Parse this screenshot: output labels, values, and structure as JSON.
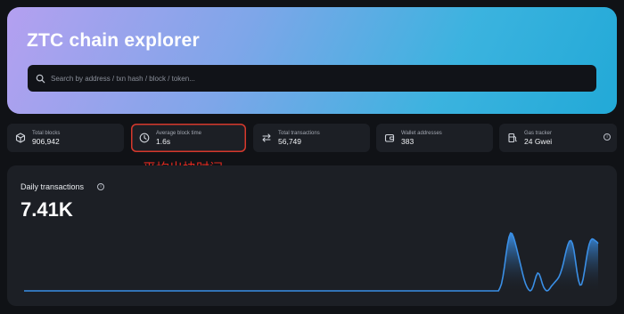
{
  "header": {
    "title": "ZTC chain explorer",
    "search_placeholder": "Search by address / txn hash / block / token..."
  },
  "stats": [
    {
      "label": "Total blocks",
      "value": "906,942",
      "icon": "cube-icon"
    },
    {
      "label": "Average block time",
      "value": "1.6s",
      "icon": "clock-icon"
    },
    {
      "label": "Total transactions",
      "value": "56,749",
      "icon": "transfer-arrows-icon"
    },
    {
      "label": "Wallet addresses",
      "value": "383",
      "icon": "wallet-icon"
    },
    {
      "label": "Gas tracker",
      "value": "24 Gwei",
      "icon": "gas-pump-icon"
    }
  ],
  "annotation": "平均出块时间",
  "daily": {
    "title": "Daily transactions",
    "value": "7.41K"
  },
  "chart_data": {
    "type": "area",
    "values": [
      0,
      0,
      0,
      0,
      0,
      0,
      0,
      0,
      0,
      0,
      0,
      0,
      0,
      0,
      0,
      0,
      0,
      0,
      0,
      0,
      0,
      0,
      0,
      0,
      0,
      0,
      0,
      0,
      0,
      0,
      0,
      0,
      0,
      0,
      0,
      0,
      0,
      0,
      0,
      0,
      0,
      0,
      0,
      0,
      0,
      0,
      0,
      0,
      0,
      0,
      0,
      0,
      0,
      0,
      0,
      0,
      0,
      0,
      0,
      0,
      0,
      0,
      0,
      0,
      0,
      0,
      0,
      0,
      0,
      0,
      0,
      0,
      0,
      0,
      0,
      0,
      0,
      0,
      0,
      0,
      0,
      0,
      0,
      0,
      0,
      0,
      0,
      0,
      0,
      0,
      0,
      0,
      0,
      0,
      0,
      0,
      0,
      0,
      0,
      0,
      0,
      0,
      0,
      0,
      0,
      0,
      0,
      0,
      0,
      0,
      0,
      0,
      0,
      0,
      0,
      0,
      0,
      0,
      0,
      0,
      0,
      0,
      0,
      0,
      0,
      0,
      0,
      0,
      0,
      0,
      0,
      0,
      0,
      0,
      0,
      0,
      0,
      0,
      0,
      0,
      0,
      0,
      0,
      0,
      0,
      0,
      0,
      0,
      0,
      0,
      0,
      0,
      0,
      0,
      0,
      0,
      0,
      0,
      0,
      0,
      0,
      0,
      0,
      0,
      0,
      0,
      0,
      0,
      0,
      0,
      0,
      0,
      0,
      0,
      0,
      0,
      0,
      0,
      0,
      0,
      0,
      0,
      0,
      0,
      0,
      0,
      0,
      0,
      0,
      0,
      0,
      0,
      0,
      0,
      0,
      0,
      0,
      0,
      0,
      0,
      0,
      0,
      0,
      0,
      0,
      0,
      0,
      0,
      0,
      0,
      0,
      0,
      0,
      0,
      0,
      0,
      0,
      0,
      0,
      0,
      0,
      0,
      0,
      0,
      0,
      0,
      0,
      0,
      0,
      0,
      0,
      0,
      0,
      0,
      0,
      0,
      0,
      0,
      0,
      0,
      0,
      0,
      0,
      0,
      0,
      0,
      0,
      0,
      0,
      0,
      0,
      0,
      0,
      0,
      0,
      0,
      0,
      0,
      0,
      0,
      0,
      0,
      0,
      0,
      0,
      0,
      0,
      0,
      0,
      0,
      0,
      0,
      0,
      0,
      0,
      0,
      0,
      0,
      0,
      0,
      0,
      0,
      0,
      0,
      0,
      0,
      0,
      0,
      0,
      0,
      0,
      0,
      0,
      0,
      0,
      0,
      0,
      0,
      0,
      0,
      0,
      0,
      0,
      0,
      0,
      0,
      0,
      0,
      0,
      0,
      0,
      0,
      0,
      0,
      0,
      0.05,
      0.12,
      0.25,
      0.42,
      0.62,
      0.8,
      0.93,
      1,
      0.99,
      0.93,
      0.84,
      0.74,
      0.63,
      0.52,
      0.41,
      0.3,
      0.2,
      0.12,
      0.06,
      0.02,
      0,
      0.02,
      0.08,
      0.17,
      0.26,
      0.31,
      0.29,
      0.22,
      0.13,
      0.06,
      0.02,
      0,
      0.01,
      0.04,
      0.08,
      0.11,
      0.14,
      0.17,
      0.2,
      0.24,
      0.3,
      0.38,
      0.48,
      0.6,
      0.71,
      0.8,
      0.86,
      0.87,
      0.82,
      0.7,
      0.52,
      0.33,
      0.18,
      0.1,
      0.11,
      0.2,
      0.35,
      0.52,
      0.68,
      0.8,
      0.87,
      0.9,
      0.89,
      0.87,
      0.85,
      0.82
    ],
    "color": "#3a8fe6",
    "grid": false,
    "legend": "none"
  }
}
